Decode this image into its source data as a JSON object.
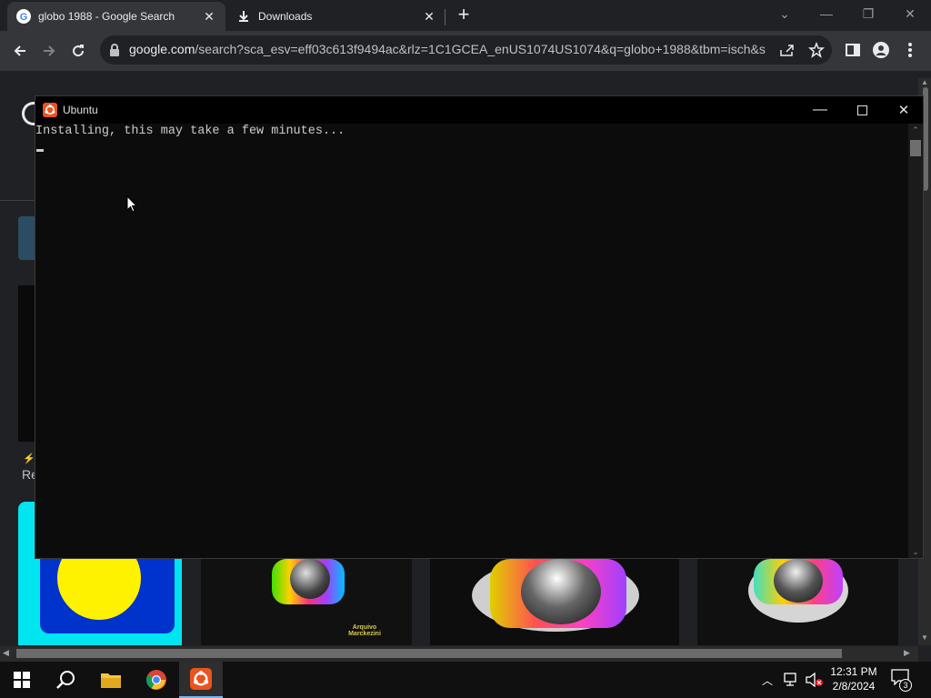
{
  "browser": {
    "tabs": [
      {
        "title": "globo 1988 - Google Search",
        "icon": "google-icon"
      },
      {
        "title": "Downloads",
        "icon": "download-icon"
      }
    ],
    "new_tab_label": "+",
    "url_domain": "google.com",
    "url_rest": "/search?sca_esv=eff03c613f9494ac&rlz=1C1GCEA_enUS1074US1074&q=globo+1988&tbm=isch&s...",
    "partial_text": "Re",
    "thumb_caption": "Arquivo\nMarckezini"
  },
  "terminal": {
    "title": "Ubuntu",
    "output": "Installing, this may take a few minutes..."
  },
  "taskbar": {
    "time": "12:31 PM",
    "date": "2/8/2024",
    "notification_count": "3"
  },
  "colors": {
    "ubuntu_orange": "#e95420",
    "chrome_dark": "#202124",
    "accent": "#76b9ed"
  }
}
